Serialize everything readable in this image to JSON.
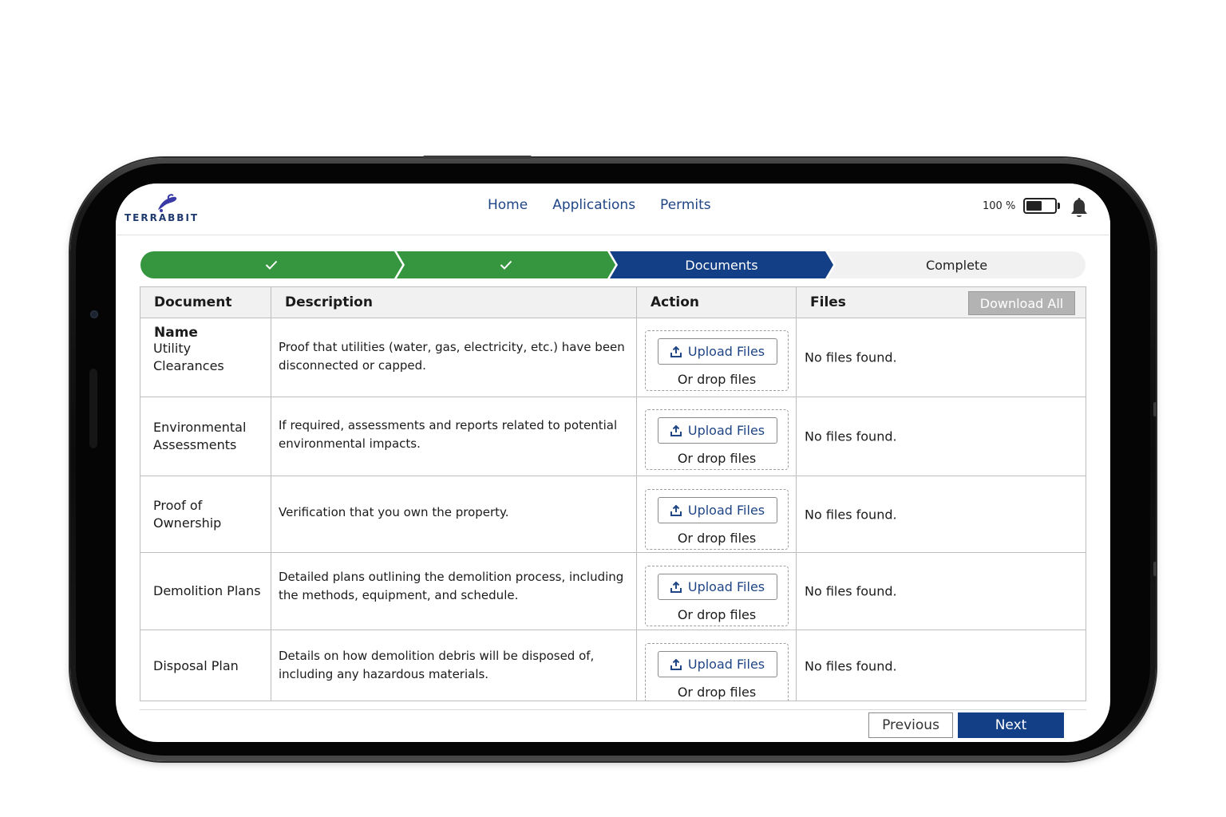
{
  "brand": {
    "name": "TERRABBIT",
    "color": "#3a3aa6"
  },
  "nav": {
    "items": [
      "Home",
      "Applications",
      "Permits"
    ]
  },
  "status": {
    "battery_text": "100 %",
    "battery_level": 0.55
  },
  "stepper": {
    "steps": [
      {
        "label": "",
        "state": "done",
        "icon": "check-icon"
      },
      {
        "label": "",
        "state": "done",
        "icon": "check-icon"
      },
      {
        "label": "Documents",
        "state": "current"
      },
      {
        "label": "Complete",
        "state": "upcoming"
      }
    ],
    "colors": {
      "done": "#35963f",
      "current": "#123f85",
      "upcoming": "#f1f1f1"
    }
  },
  "table": {
    "headers": {
      "name": "Document Name",
      "description": "Description",
      "action": "Action",
      "files": "Files"
    },
    "download_all_label": "Download All",
    "rows": [
      {
        "name": "Utility Clearances",
        "description": "Proof that utilities (water, gas, electricity, etc.) have been disconnected or capped.",
        "upload_label": "Upload Files",
        "drop_label": "Or drop files",
        "files": "No files found."
      },
      {
        "name": "Environmental Assessments",
        "description": "If required, assessments and reports related to potential environmental impacts.",
        "upload_label": "Upload Files",
        "drop_label": "Or drop files",
        "files": "No files found."
      },
      {
        "name": "Proof of Ownership",
        "description": "Verification that you own the property.",
        "upload_label": "Upload Files",
        "drop_label": "Or drop files",
        "files": "No files found."
      },
      {
        "name": "Demolition Plans",
        "description": "Detailed plans outlining the demolition process, including the methods, equipment, and schedule.",
        "upload_label": "Upload Files",
        "drop_label": "Or drop files",
        "files": "No files found."
      },
      {
        "name": "Disposal Plan",
        "description": "Details on how demolition debris will be disposed of, including any hazardous materials.",
        "upload_label": "Upload Files",
        "drop_label": "Or drop files",
        "files": "No files found."
      }
    ]
  },
  "footer": {
    "previous_label": "Previous",
    "next_label": "Next"
  }
}
